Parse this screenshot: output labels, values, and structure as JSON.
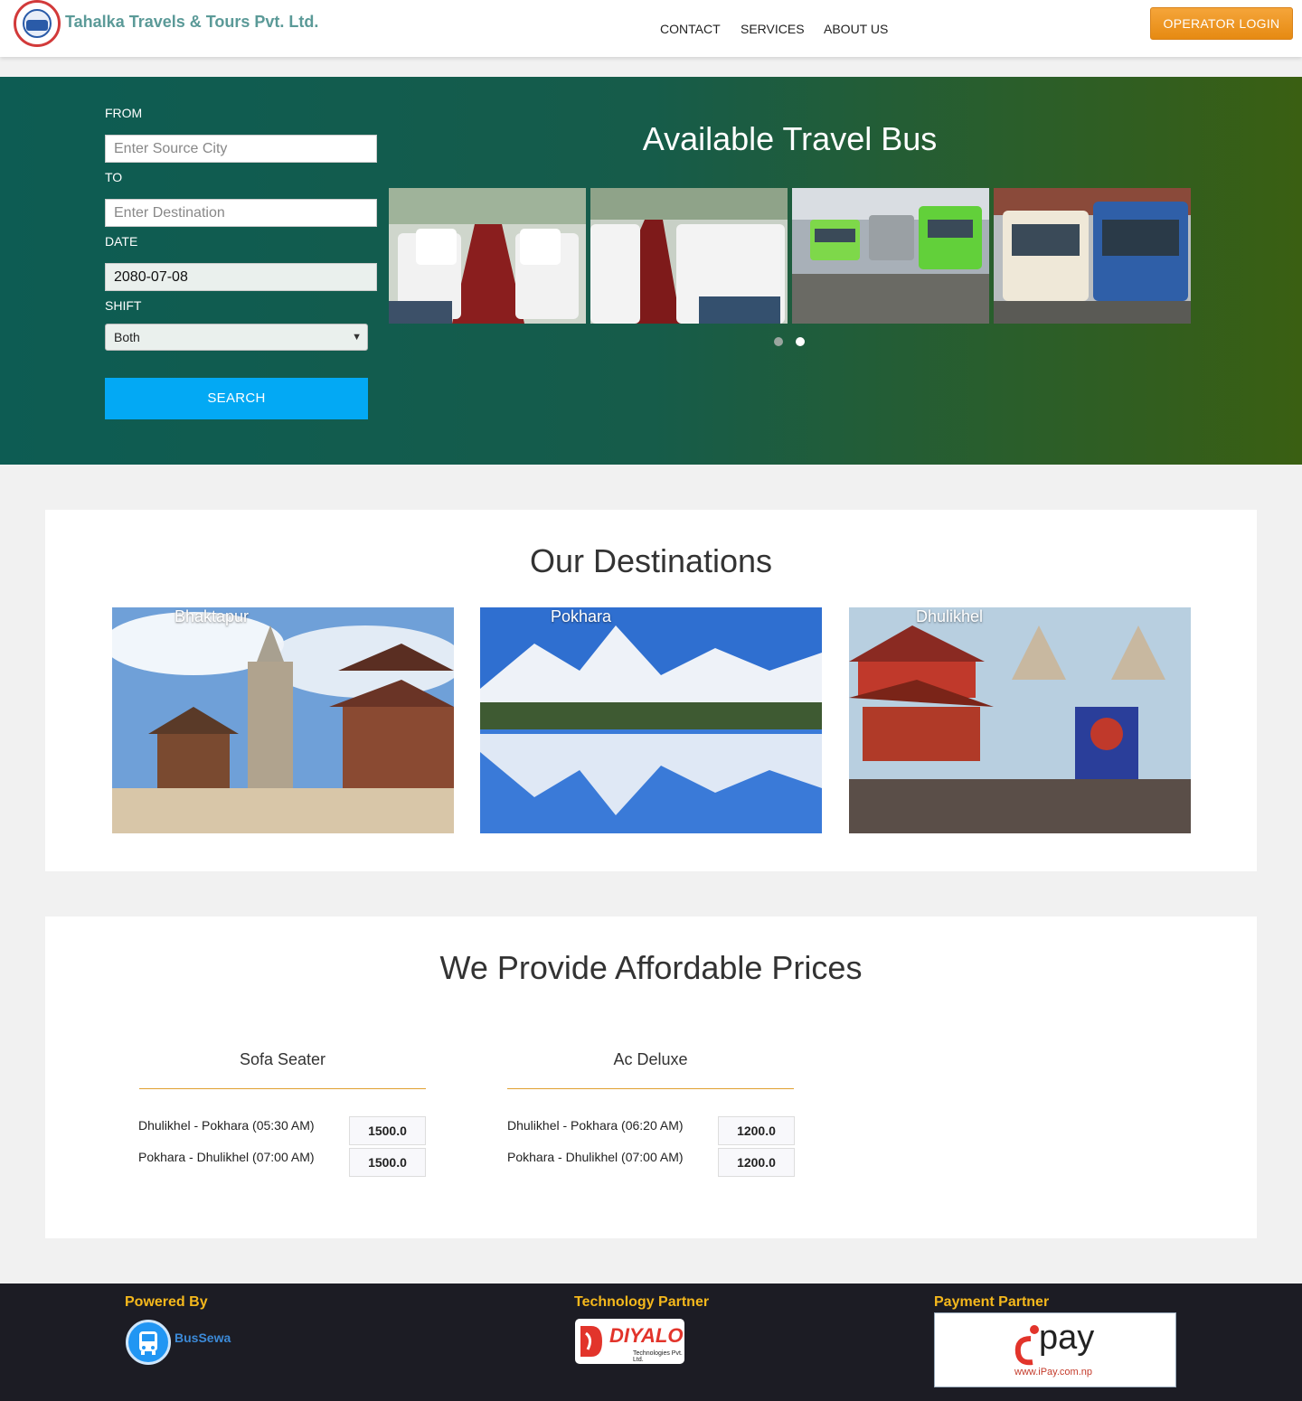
{
  "header": {
    "brand": "Tahalka Travels & Tours Pvt. Ltd.",
    "nav": {
      "contact": "CONTACT",
      "services": "SERVICES",
      "about": "ABOUT US"
    },
    "operator_login": "OPERATOR LOGIN"
  },
  "search": {
    "from_label": "FROM",
    "from_placeholder": "Enter Source City",
    "to_label": "TO",
    "to_placeholder": "Enter Destination",
    "date_label": "DATE",
    "date_value": "2080-07-08",
    "shift_label": "SHIFT",
    "shift_value": "Both",
    "search_button": "SEARCH"
  },
  "carousel": {
    "title": "Available Travel Bus",
    "active_slide": 2,
    "slide_count": 2
  },
  "destinations": {
    "title": "Our Destinations",
    "items": [
      {
        "name": "Bhaktapur"
      },
      {
        "name": "Pokhara"
      },
      {
        "name": "Dhulikhel"
      }
    ]
  },
  "prices": {
    "title": "We Provide Affordable Prices",
    "categories": [
      {
        "name": "Sofa Seater",
        "routes": [
          {
            "route": "Dhulikhel - Pokhara (05:30 AM)",
            "price": "1500.0"
          },
          {
            "route": "Pokhara - Dhulikhel (07:00 AM)",
            "price": "1500.0"
          }
        ]
      },
      {
        "name": "Ac Deluxe",
        "routes": [
          {
            "route": "Dhulikhel - Pokhara (06:20 AM)",
            "price": "1200.0"
          },
          {
            "route": "Pokhara - Dhulikhel (07:00 AM)",
            "price": "1200.0"
          }
        ]
      }
    ]
  },
  "footer": {
    "powered_by": "Powered By",
    "powered_name": "BusSewa",
    "tech_partner": "Technology Partner",
    "tech_logo_text": "DIYALO",
    "tech_logo_sub": "Technologies Pvt. Ltd.",
    "payment_partner": "Payment Partner",
    "payment_logo_text": "pay",
    "payment_logo_url": "www.iPay.com.np"
  },
  "colors": {
    "brand": "#5b9a98",
    "accent": "#f5a53a",
    "search_button": "#03a9f4",
    "footer_title": "#f5b81c"
  }
}
